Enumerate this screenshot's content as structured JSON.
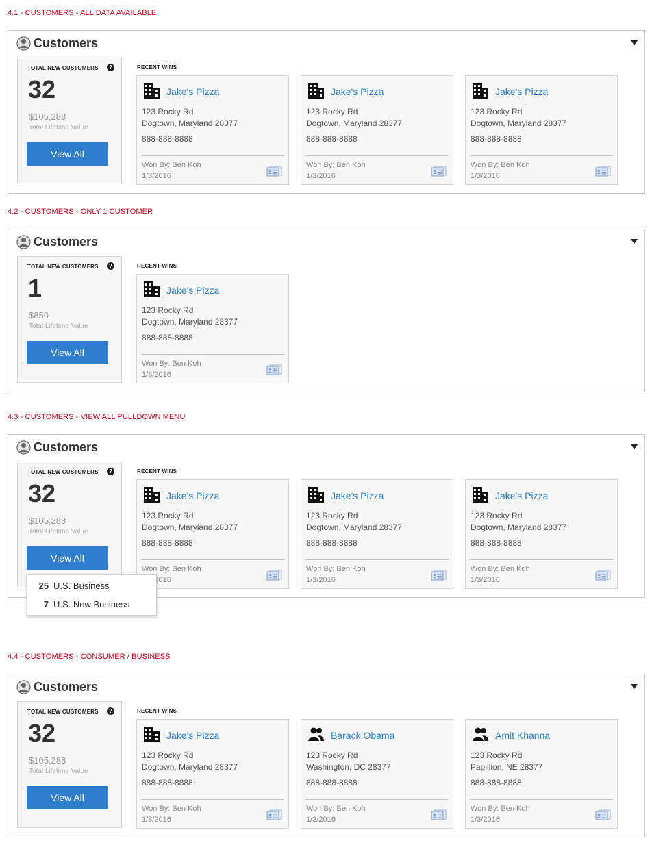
{
  "sections": [
    {
      "label": "4.1 - CUSTOMERS - ALL DATA AVAILABLE",
      "title": "Customers",
      "stats": {
        "heading": "TOTAL NEW CUSTOMERS",
        "count": "32",
        "value": "$105,288",
        "value_label": "Total Lifetime Value",
        "button": "View All"
      },
      "wins_heading": "RECENT WINS",
      "wins": [
        {
          "type": "business",
          "name": "Jake's Pizza",
          "street": "123 Rocky Rd",
          "city": "Dogtown, Maryland 28377",
          "phone": "888-888-8888",
          "won_by": "Won By: Ben Koh",
          "date": "1/3/2016"
        },
        {
          "type": "business",
          "name": "Jake's Pizza",
          "street": "123 Rocky Rd",
          "city": "Dogtown, Maryland 28377",
          "phone": "888-888-8888",
          "won_by": "Won By: Ben Koh",
          "date": "1/3/2016"
        },
        {
          "type": "business",
          "name": "Jake's Pizza",
          "street": "123 Rocky Rd",
          "city": "Dogtown, Maryland 28377",
          "phone": "888-888-8888",
          "won_by": "Won By: Ben Koh",
          "date": "1/3/2016"
        }
      ]
    },
    {
      "label": "4.2 - CUSTOMERS - ONLY 1 CUSTOMER",
      "title": "Customers",
      "stats": {
        "heading": "TOTAL NEW CUSTOMERS",
        "count": "1",
        "value": "$850",
        "value_label": "Total Lifetime Value",
        "button": "View All"
      },
      "wins_heading": "RECENT WINS",
      "wins": [
        {
          "type": "business",
          "name": "Jake's Pizza",
          "street": "123 Rocky Rd",
          "city": "Dogtown, Maryland 28377",
          "phone": "888-888-8888",
          "won_by": "Won By: Ben Koh",
          "date": "1/3/2016"
        }
      ]
    },
    {
      "label": "4.3 - CUSTOMERS - VIEW ALL PULLDOWN MENU",
      "title": "Customers",
      "stats": {
        "heading": "TOTAL NEW CUSTOMERS",
        "count": "32",
        "value": "$105,288",
        "value_label": "Total Lifetime Value",
        "button": "View All"
      },
      "wins_heading": "RECENT WINS",
      "wins": [
        {
          "type": "business",
          "name": "Jake's Pizza",
          "street": "123 Rocky Rd",
          "city": "Dogtown, Maryland 28377",
          "phone": "888-888-8888",
          "won_by": "Won By: Ben Koh",
          "date": "1/3/2016"
        },
        {
          "type": "business",
          "name": "Jake's Pizza",
          "street": "123 Rocky Rd",
          "city": "Dogtown, Maryland 28377",
          "phone": "888-888-8888",
          "won_by": "Won By: Ben Koh",
          "date": "1/3/2016"
        },
        {
          "type": "business",
          "name": "Jake's Pizza",
          "street": "123 Rocky Rd",
          "city": "Dogtown, Maryland 28377",
          "phone": "888-888-8888",
          "won_by": "Won By: Ben Koh",
          "date": "1/3/2016"
        }
      ]
    },
    {
      "label": "4.4 - CUSTOMERS - CONSUMER / BUSINESS",
      "title": "Customers",
      "stats": {
        "heading": "TOTAL NEW CUSTOMERS",
        "count": "32",
        "value": "$105,288",
        "value_label": "Total Lifetime Value",
        "button": "View All"
      },
      "wins_heading": "RECENT WINS",
      "wins": [
        {
          "type": "business",
          "name": "Jake's Pizza",
          "street": "123 Rocky Rd",
          "city": "Dogtown, Maryland 28377",
          "phone": "888-888-8888",
          "won_by": "Won By: Ben Koh",
          "date": "1/3/2016"
        },
        {
          "type": "consumer",
          "name": "Barack Obama",
          "street": "123 Rocky Rd",
          "city": "Washington, DC 28377",
          "phone": "888-888-8888",
          "won_by": "Won By: Ben Koh",
          "date": "1/3/2016"
        },
        {
          "type": "consumer",
          "name": "Amit Khanna",
          "street": "123 Rocky Rd",
          "city": "Papillion, NE 28377",
          "phone": "888-888-8888",
          "won_by": "Won By: Ben Koh",
          "date": "1/3/2016"
        }
      ]
    }
  ],
  "view_all_menu": [
    {
      "count": "25",
      "label": "U.S. Business"
    },
    {
      "count": "7",
      "label": "U.S. New Business"
    }
  ],
  "colors": {
    "accent": "#2f7dcd",
    "link": "#2a7fcb",
    "label_red": "#d0021b"
  }
}
